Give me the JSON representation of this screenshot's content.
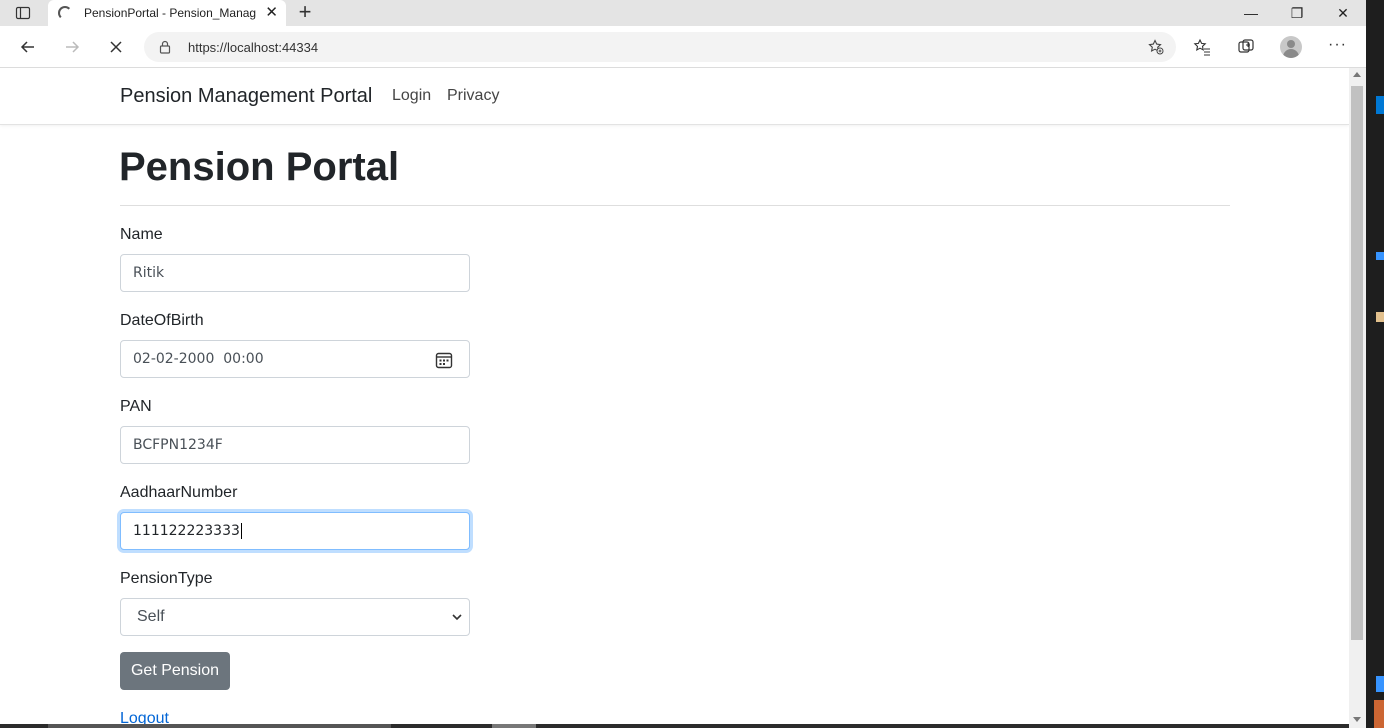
{
  "browser": {
    "tab_title": "PensionPortal - Pension_Management",
    "url": "https://localhost:44334"
  },
  "navbar": {
    "brand": "Pension Management Portal",
    "links": [
      "Login",
      "Privacy"
    ]
  },
  "main": {
    "title": "Pension Portal",
    "fields": {
      "name": {
        "label": "Name",
        "value": "Ritik"
      },
      "dob": {
        "label": "DateOfBirth",
        "value": "02-02-2000  00:00"
      },
      "pan": {
        "label": "PAN",
        "value": "BCFPN1234F"
      },
      "aadhaar": {
        "label": "AadhaarNumber",
        "value": "111122223333"
      },
      "pension_type": {
        "label": "PensionType",
        "value": "Self"
      }
    },
    "submit_label": "Get Pension",
    "logout_label": "Logout"
  },
  "colors": {
    "button": "#6c757d",
    "link": "#0366d6",
    "focus_border": "#80bdff"
  }
}
